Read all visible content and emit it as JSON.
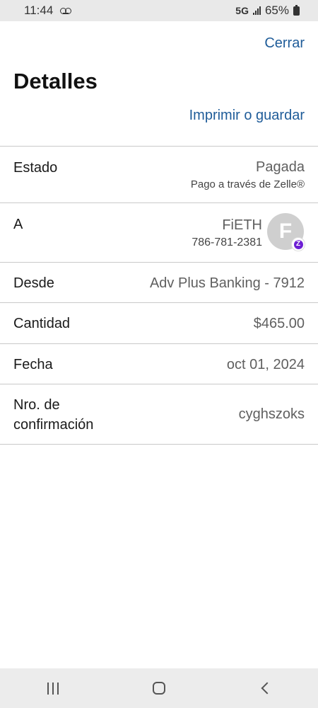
{
  "status_bar": {
    "time": "11:44",
    "network": "5G",
    "battery": "65%"
  },
  "header": {
    "close_label": "Cerrar",
    "title": "Detalles",
    "print_label": "Imprimir o guardar"
  },
  "details": {
    "estado": {
      "label": "Estado",
      "value": "Pagada",
      "sub": "Pago a través de Zelle®"
    },
    "recipient": {
      "label": "A",
      "name": "FiETH",
      "phone": "786-781-2381",
      "avatar_initial": "F",
      "badge": "Z"
    },
    "desde": {
      "label": "Desde",
      "value": "Adv Plus Banking - 7912"
    },
    "cantidad": {
      "label": "Cantidad",
      "value": "$465.00"
    },
    "fecha": {
      "label": "Fecha",
      "value": "oct 01, 2024"
    },
    "confirmacion": {
      "label_line1": "Nro. de",
      "label_line2": "confirmación",
      "value": "cyghszoks"
    }
  },
  "colors": {
    "link": "#1f5c99",
    "zelle_purple": "#6d1ed4"
  },
  "icons": {
    "nav": [
      "recent-apps-icon",
      "home-icon",
      "back-icon"
    ]
  }
}
